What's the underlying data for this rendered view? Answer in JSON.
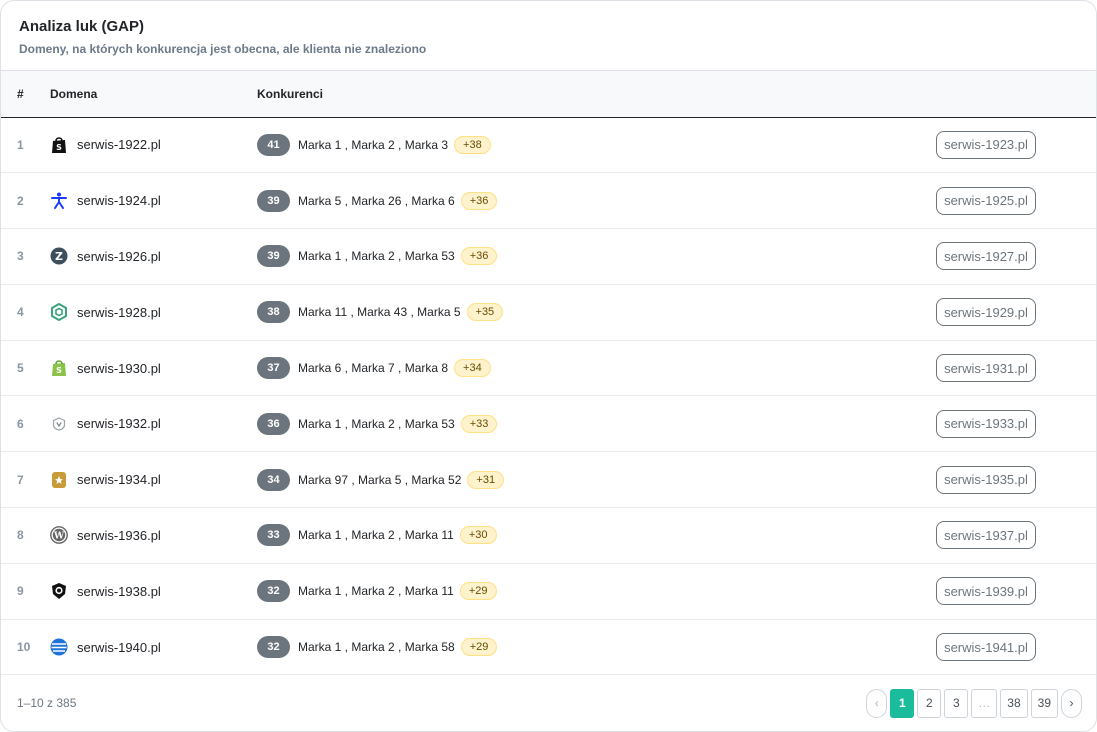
{
  "header": {
    "title": "Analiza luk (GAP)",
    "subtitle": "Domeny, na których konkurencja jest obecna, ale klienta nie znaleziono"
  },
  "table": {
    "columns": [
      "#",
      "Domena",
      "Konkurenci"
    ],
    "rows": [
      {
        "num": "1",
        "domain": "serwis-1922.pl",
        "icon": "shopify-bag-dark-icon",
        "count": "41",
        "brands": "Marka 1 , Marka 2 , Marka 3",
        "more": "+38",
        "action": "serwis-1923.pl"
      },
      {
        "num": "2",
        "domain": "serwis-1924.pl",
        "icon": "accessibility-person-icon",
        "count": "39",
        "brands": "Marka 5 , Marka 26 , Marka 6",
        "more": "+36",
        "action": "serwis-1925.pl"
      },
      {
        "num": "3",
        "domain": "serwis-1926.pl",
        "icon": "letter-z-circle-icon",
        "count": "39",
        "brands": "Marka 1 , Marka 2 , Marka 53",
        "more": "+36",
        "action": "serwis-1927.pl"
      },
      {
        "num": "4",
        "domain": "serwis-1928.pl",
        "icon": "green-hexagon-icon",
        "count": "38",
        "brands": "Marka 11 , Marka 43 , Marka 5",
        "more": "+35",
        "action": "serwis-1929.pl"
      },
      {
        "num": "5",
        "domain": "serwis-1930.pl",
        "icon": "shopify-bag-green-icon",
        "count": "37",
        "brands": "Marka 6 , Marka 7 , Marka 8",
        "more": "+34",
        "action": "serwis-1931.pl"
      },
      {
        "num": "6",
        "domain": "serwis-1932.pl",
        "icon": "shield-v-icon",
        "count": "36",
        "brands": "Marka 1 , Marka 2 , Marka 53",
        "more": "+33",
        "action": "serwis-1933.pl"
      },
      {
        "num": "7",
        "domain": "serwis-1934.pl",
        "icon": "gold-badge-icon",
        "count": "34",
        "brands": "Marka 97 , Marka 5 , Marka 52",
        "more": "+31",
        "action": "serwis-1935.pl"
      },
      {
        "num": "8",
        "domain": "serwis-1936.pl",
        "icon": "wordpress-icon",
        "count": "33",
        "brands": "Marka 1 , Marka 2 , Marka 11",
        "more": "+30",
        "action": "serwis-1937.pl"
      },
      {
        "num": "9",
        "domain": "serwis-1938.pl",
        "icon": "lion-shield-icon",
        "count": "32",
        "brands": "Marka 1 , Marka 2 , Marka 11",
        "more": "+29",
        "action": "serwis-1939.pl"
      },
      {
        "num": "10",
        "domain": "serwis-1940.pl",
        "icon": "blue-sphere-icon",
        "count": "32",
        "brands": "Marka 1 , Marka 2 , Marka 58",
        "more": "+29",
        "action": "serwis-1941.pl"
      }
    ]
  },
  "footer": {
    "range": "1–10 z 385",
    "pagination": {
      "prev": "‹",
      "pages": [
        "1",
        "2",
        "3",
        "…",
        "38",
        "39"
      ],
      "active": "1",
      "next": "›"
    }
  },
  "colors": {
    "accent": "#1abc9c",
    "count_pill": "#6c757d",
    "more_pill_bg": "#fff3cd"
  }
}
